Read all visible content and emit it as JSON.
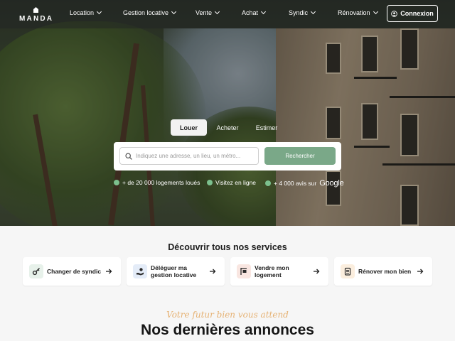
{
  "brand": {
    "name": "MANDA"
  },
  "nav": {
    "items": [
      {
        "label": "Location"
      },
      {
        "label": "Gestion locative"
      },
      {
        "label": "Vente"
      },
      {
        "label": "Achat"
      },
      {
        "label": "Syndic"
      },
      {
        "label": "Rénovation"
      }
    ],
    "login_label": "Connexion"
  },
  "hero": {
    "tabs": [
      {
        "label": "Louer",
        "active": true
      },
      {
        "label": "Acheter",
        "active": false
      },
      {
        "label": "Estimer",
        "active": false
      }
    ],
    "search": {
      "placeholder": "Indiquez une adresse, un lieu, un métro...",
      "button_label": "Rechercher"
    },
    "stats": [
      {
        "label": "+ de 20 000 logements loués"
      },
      {
        "label": "Visitez en ligne"
      },
      {
        "label": "+ 4 000 avis sur"
      }
    ],
    "google_label": "Google"
  },
  "services": {
    "title": "Découvrir tous nos services",
    "items": [
      {
        "label": "Changer de syndic",
        "icon": "key-icon",
        "icon_bg": "#e7f1ea"
      },
      {
        "label": "Déléguer ma gestion locative",
        "icon": "hand-coin-icon",
        "icon_bg": "#e4ecf8"
      },
      {
        "label": "Vendre mon logement",
        "icon": "house-sign-icon",
        "icon_bg": "#f9e6e1"
      },
      {
        "label": "Rénover mon bien",
        "icon": "clipboard-icon",
        "icon_bg": "#fbeede"
      }
    ]
  },
  "listings": {
    "tagline": "Votre futur bien vous attend",
    "title": "Nos dernières annonces"
  },
  "colors": {
    "accent_green": "#7aa888",
    "stat_dot": "#7cc08e",
    "tagline_gold": "#e6b274"
  }
}
